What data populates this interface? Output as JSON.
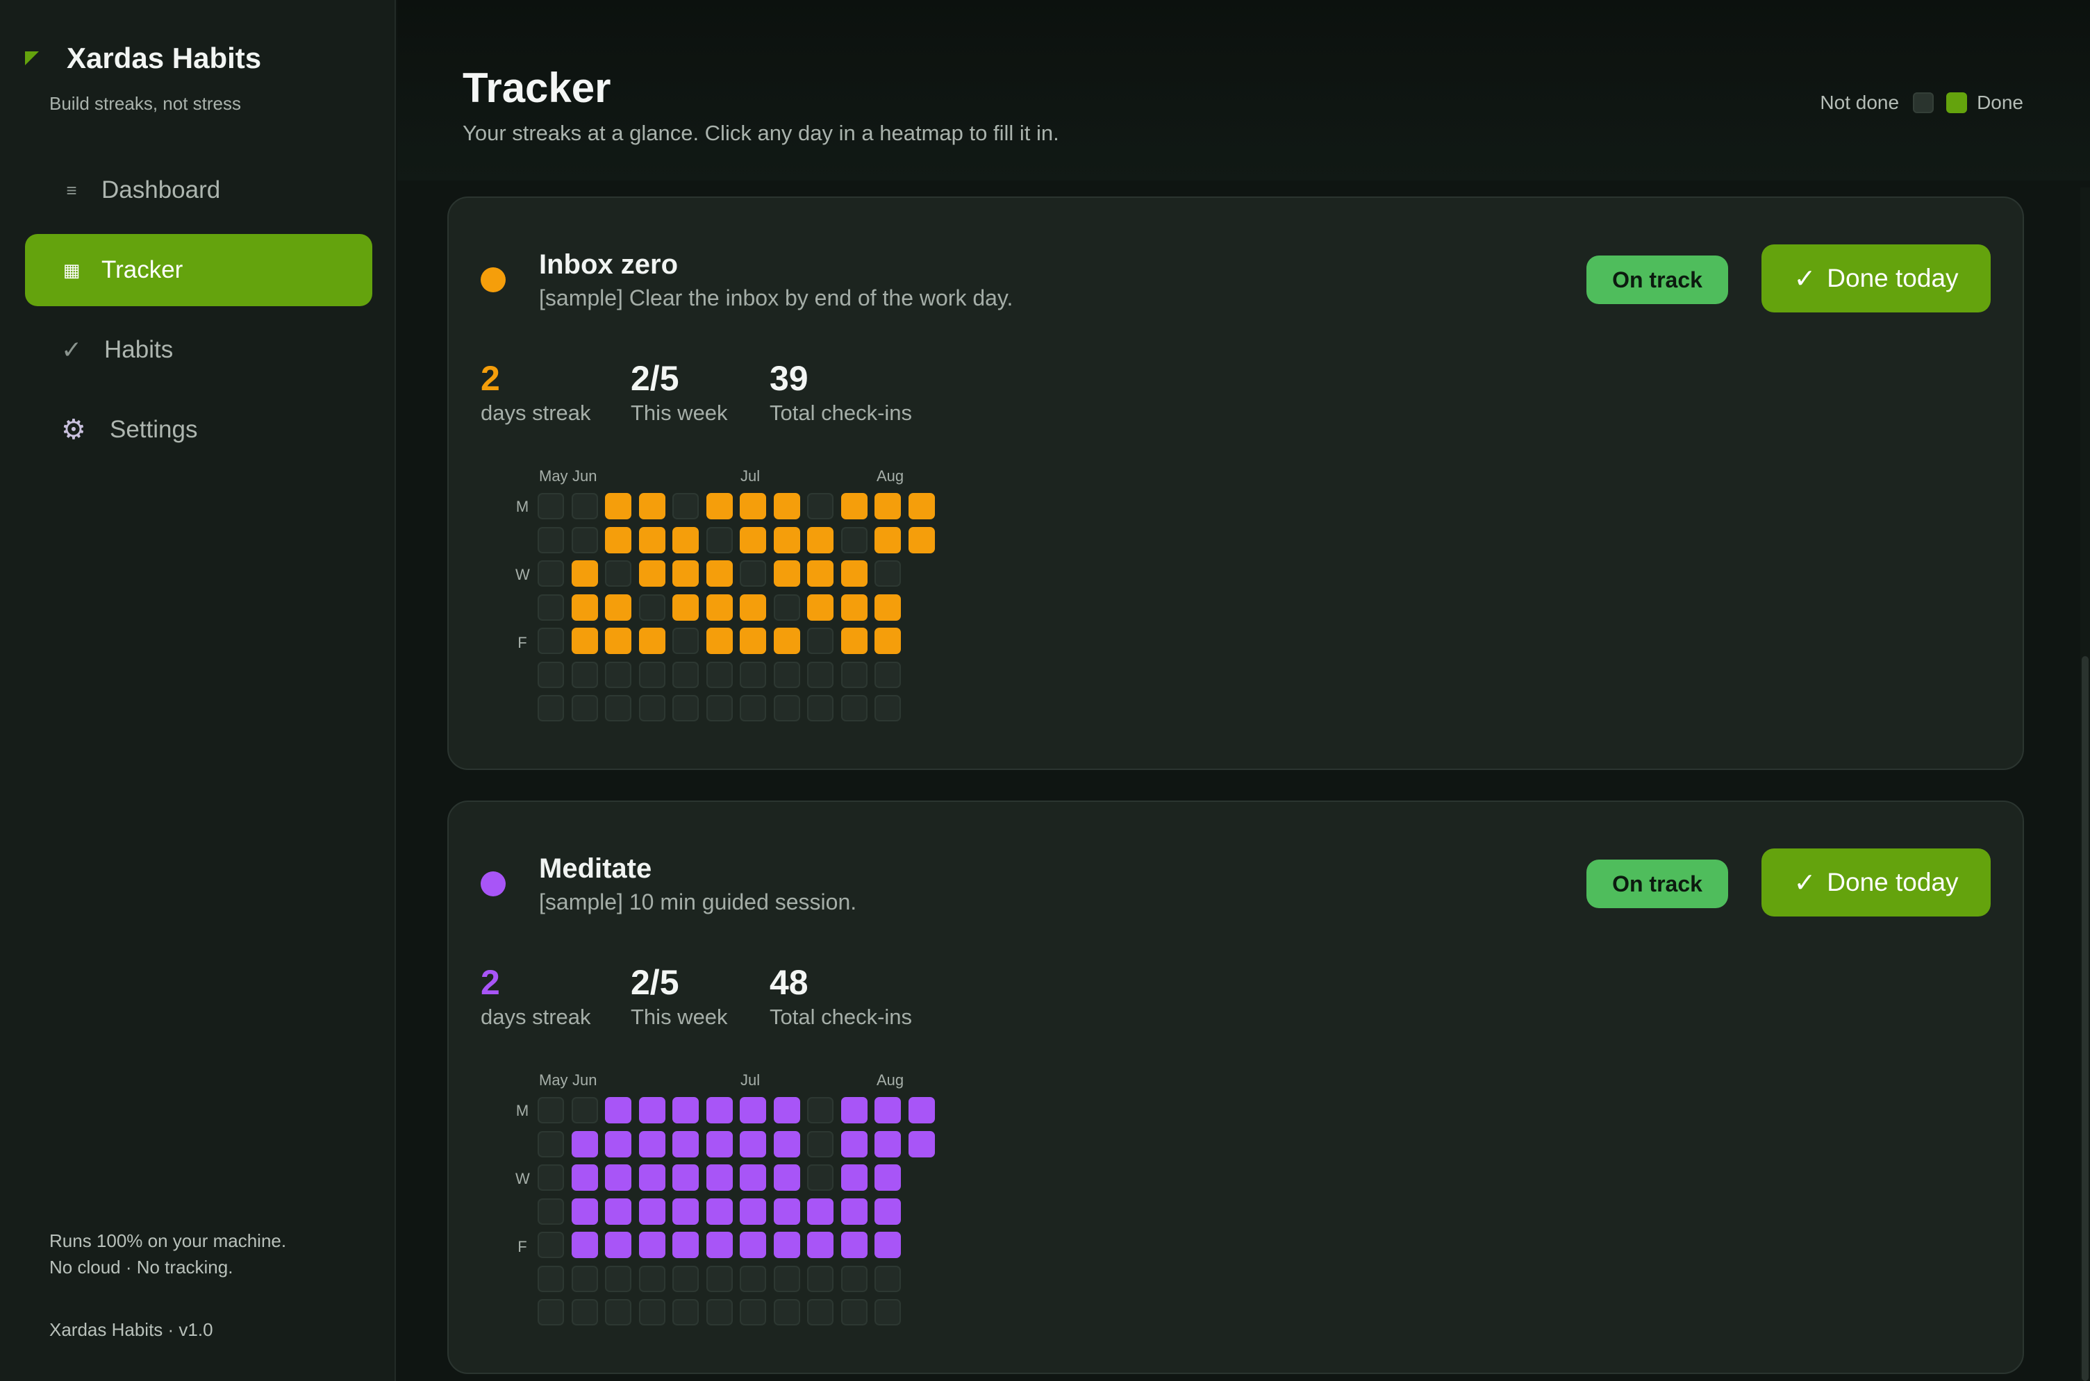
{
  "app": {
    "name": "Xardas Habits",
    "tagline": "Build streaks, not stress",
    "accent": "#64a30d"
  },
  "nav": [
    {
      "label": "Dashboard",
      "icon": "list-icon",
      "active": false
    },
    {
      "label": "Tracker",
      "icon": "grid-icon",
      "active": true
    },
    {
      "label": "Habits",
      "icon": "check-icon",
      "active": false
    },
    {
      "label": "Settings",
      "icon": "gear-icon",
      "active": false
    }
  ],
  "sidebar_footer": {
    "privacy_line1": "Runs 100% on your machine.",
    "privacy_line2": "No cloud · No tracking.",
    "version": "Xardas Habits · v1.0"
  },
  "header": {
    "title": "Tracker",
    "subtitle": "Your streaks at a glance. Click any day in a heatmap to fill it in.",
    "legend_off": "Not done",
    "legend_on": "Done"
  },
  "heatmap_labels": {
    "months": [
      "May",
      "Jun",
      "Jul",
      "Aug"
    ],
    "days": [
      "M",
      "W",
      "F"
    ]
  },
  "habits": [
    {
      "name": "Inbox zero",
      "description": "[sample] Clear the inbox by end of the work day.",
      "color": "#f59e0b",
      "status": "On track",
      "button": "Done today",
      "streak": "2",
      "streak_label": "days streak",
      "week": "2/5",
      "week_label": "This week",
      "total": "39",
      "total_label": "Total check-ins",
      "today": [
        1,
        11
      ],
      "grid": [
        "001101110111",
        "001110111011",
        "01011101110",
        "01101110111",
        "01110111011",
        "00000000000",
        "00000000000"
      ]
    },
    {
      "name": "Meditate",
      "description": "[sample] 10 min guided session.",
      "color": "#a855f7",
      "status": "On track",
      "button": "Done today",
      "streak": "2",
      "streak_label": "days streak",
      "week": "2/5",
      "week_label": "This week",
      "total": "48",
      "total_label": "Total check-ins",
      "today": [
        1,
        11
      ],
      "grid": [
        "001111110111",
        "011111110111",
        "01111111011",
        "01111111111",
        "01111111111",
        "00000000000",
        "00000000000"
      ]
    }
  ]
}
